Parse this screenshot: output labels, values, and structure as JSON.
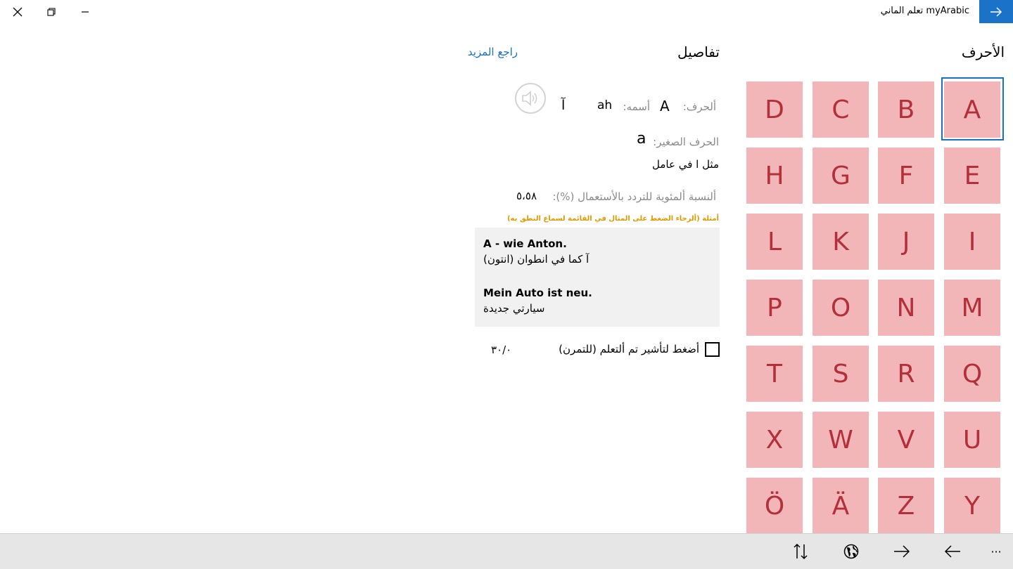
{
  "titlebar": {
    "app_title": "myArabic تعلم الماني",
    "back_icon": "arrow-right-icon",
    "close_icon": "close-icon",
    "restore_icon": "restore-icon",
    "minimize_icon": "minimize-icon"
  },
  "letters_panel": {
    "header": "الأحرف",
    "selected": "A",
    "tiles": [
      "A",
      "B",
      "C",
      "D",
      "E",
      "F",
      "G",
      "H",
      "I",
      "J",
      "K",
      "L",
      "M",
      "N",
      "O",
      "P",
      "Q",
      "R",
      "S",
      "T",
      "U",
      "V",
      "W",
      "X",
      "Y",
      "Z",
      "Ä",
      "Ö"
    ]
  },
  "details": {
    "header": "تفاصيل",
    "see_more": "راجع المزيد",
    "letter_label": "ألحرف:",
    "letter_value": "A",
    "name_label": "أسمه:",
    "name_value": "ah",
    "arabic_letter": "آ",
    "speaker_icon": "speaker-icon",
    "small_letter_label": "الحرف الصغير:",
    "small_letter_value": "a",
    "like_text": "مثل ا في عامل",
    "frequency_label": "ألنسبة ألمئوية للتردد بالأستعمال (%):",
    "frequency_value": "٥،٥٨",
    "examples_hint": "أمثلة (ألرجاء الضغط على المثال في القائمة لسماع النطق به)",
    "examples": [
      {
        "de": "A - wie Anton.",
        "ar": "آ كما في انطوان (انتون)"
      },
      {
        "de": "Mein Auto ist neu.",
        "ar": "سيارتي جديدة"
      }
    ],
    "learned_checkbox_label": "أضغط لتأشير تم ألتعلم (للتمرن)",
    "learned_counter": "٣٠/٠"
  },
  "bottom_bar": {
    "more_icon": "more-icon",
    "prev_icon": "arrow-left-icon",
    "next_icon": "arrow-right-icon",
    "globe_icon": "globe-icon",
    "sort_icon": "sort-icon",
    "more_label": "···"
  },
  "colors": {
    "accent": "#1a73c8",
    "tile_bg": "#f2b6b8",
    "tile_text": "#b3303a",
    "hint": "#e09a00"
  }
}
